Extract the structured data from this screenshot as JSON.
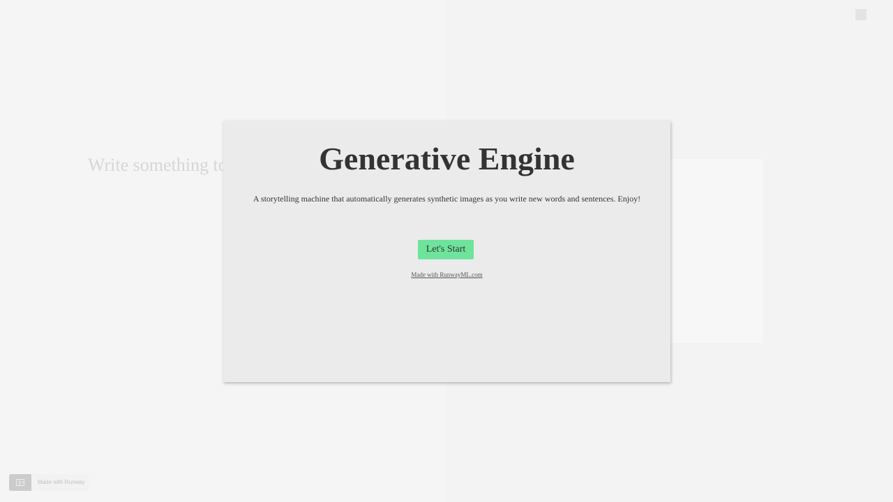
{
  "editor": {
    "placeholder": "Write something to g"
  },
  "modal": {
    "title": "Generative Engine",
    "description": "A storytelling machine that automatically generates synthetic images as you write new words and sentences. Enjoy!",
    "start_button": "Let's Start",
    "made_with_link": "Made with RunwayML.com"
  },
  "badge": {
    "text": "Made with Runway",
    "logo_icon": "runway-logo-icon"
  },
  "view_controls": {
    "single_icon": "single-view-icon",
    "grid_icon": "grid-view-icon"
  },
  "colors": {
    "accent": "#6ee39c",
    "modal_bg": "#ebebeb",
    "page_bg": "#f5f5f5",
    "text": "#333333"
  }
}
